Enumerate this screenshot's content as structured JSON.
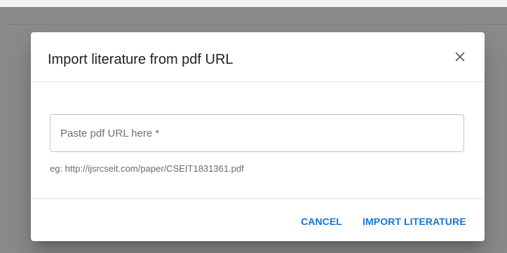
{
  "dialog": {
    "title": "Import literature from pdf URL",
    "close_icon": "close-icon",
    "url_field": {
      "placeholder": "Paste pdf URL here *",
      "value": ""
    },
    "helper_text": "eg: http://ijsrcseit.com/paper/CSEIT1831361.pdf",
    "actions": {
      "cancel_label": "CANCEL",
      "import_label": "IMPORT LITERATURE"
    }
  },
  "colors": {
    "accent": "#1976d2",
    "backdrop": "#8a8a8a",
    "surface": "#ffffff"
  }
}
